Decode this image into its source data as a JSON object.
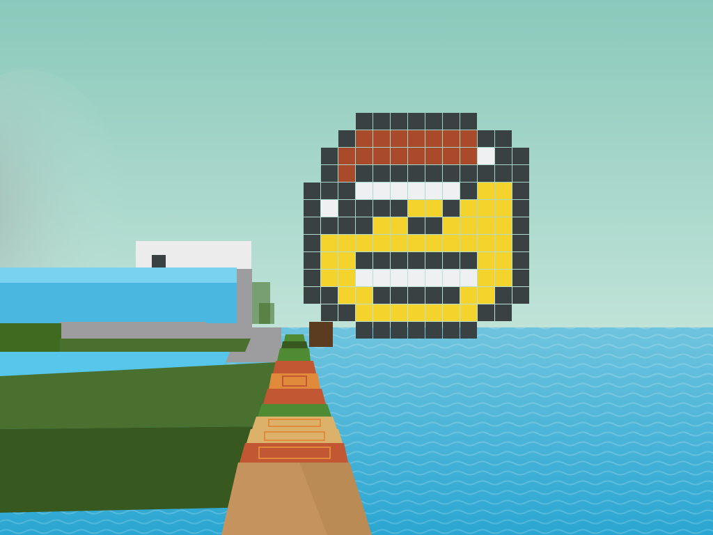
{
  "colors": {
    "sky_top": "#8ac9bb",
    "sky_horizon": "#c1e3d8",
    "haze": "#9fb1ac",
    "water": "#2aa6d2",
    "water_light": "#56c6ea",
    "water_far": "#6fc4de",
    "ice_block": "#4ab7e1",
    "ice_block_top": "#79d2ef",
    "snow_block": "#ececec",
    "stone_block": "#9d9d9f",
    "grass": "#49702e",
    "grass_dark": "#37591f",
    "leaves": "#3f6a1f",
    "path_dirt": "#c5945e",
    "path_dirt_dark": "#a97b46",
    "tile_red": "#c25733",
    "tile_orange": "#e28a3c",
    "tile_tan": "#dcb16a",
    "tile_green": "#4f8b32",
    "pixelart_outline": "#3a4143",
    "pixelart_yellow": "#f4d32c",
    "pixelart_white": "#eef0f2",
    "pixelart_red": "#a94b2a",
    "chest": "#5c3c20"
  }
}
